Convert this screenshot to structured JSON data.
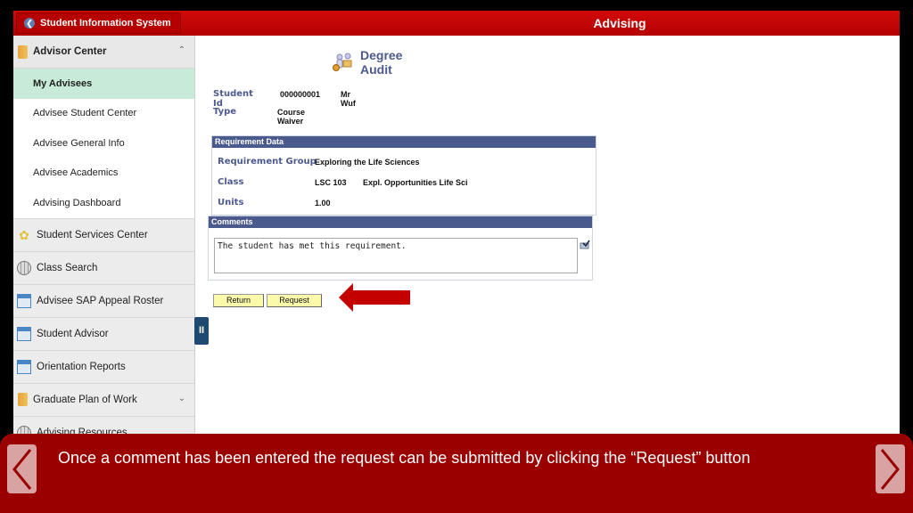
{
  "header": {
    "back_label": "Student Information System",
    "title": "Advising"
  },
  "sidebar": {
    "groups": [
      {
        "label": "Advisor Center",
        "icon": "folder-icon",
        "expanded": true,
        "items": [
          {
            "label": "My Advisees",
            "active": true
          },
          {
            "label": "Advisee Student Center"
          },
          {
            "label": "Advisee General Info"
          },
          {
            "label": "Advisee Academics"
          },
          {
            "label": "Advising Dashboard"
          }
        ]
      },
      {
        "label": "Student Services Center",
        "icon": "lightbulb-icon"
      },
      {
        "label": "Class Search",
        "icon": "globe-icon"
      },
      {
        "label": "Advisee SAP Appeal Roster",
        "icon": "window-icon"
      },
      {
        "label": "Student Advisor",
        "icon": "window-icon"
      },
      {
        "label": "Orientation Reports",
        "icon": "window-icon"
      },
      {
        "label": "Graduate Plan of Work",
        "icon": "folder-icon",
        "expanded": false
      },
      {
        "label": "Advising Resources",
        "icon": "globe-icon"
      }
    ],
    "collapse_handle": "II"
  },
  "main": {
    "title": "Degree Audit",
    "student_id_label": "Student Id",
    "student_id": "000000001",
    "student_name": "Mr Wuf",
    "type_label": "Type",
    "type_value": "Course Waiver",
    "requirement": {
      "header": "Requirement Data",
      "group_label": "Requirement Group",
      "group_value": "Exploring the Life Sciences",
      "class_label": "Class",
      "class_code": "LSC 103",
      "class_desc": "Expl. Opportunities Life Sci",
      "units_label": "Units",
      "units_value": "1.00"
    },
    "comments": {
      "header": "Comments",
      "text": "The student has met this requirement."
    },
    "buttons": {
      "return": "Return",
      "request": "Request"
    }
  },
  "caption": {
    "text": "Once a comment has been entered the request can be submitted by clicking the “Request” button"
  },
  "colors": {
    "brand_red": "#c00000",
    "caption_red": "#9a0000",
    "section_header": "#4a5a8c",
    "active_item": "#c8ead8",
    "button_yellow": "#fafaaa"
  }
}
